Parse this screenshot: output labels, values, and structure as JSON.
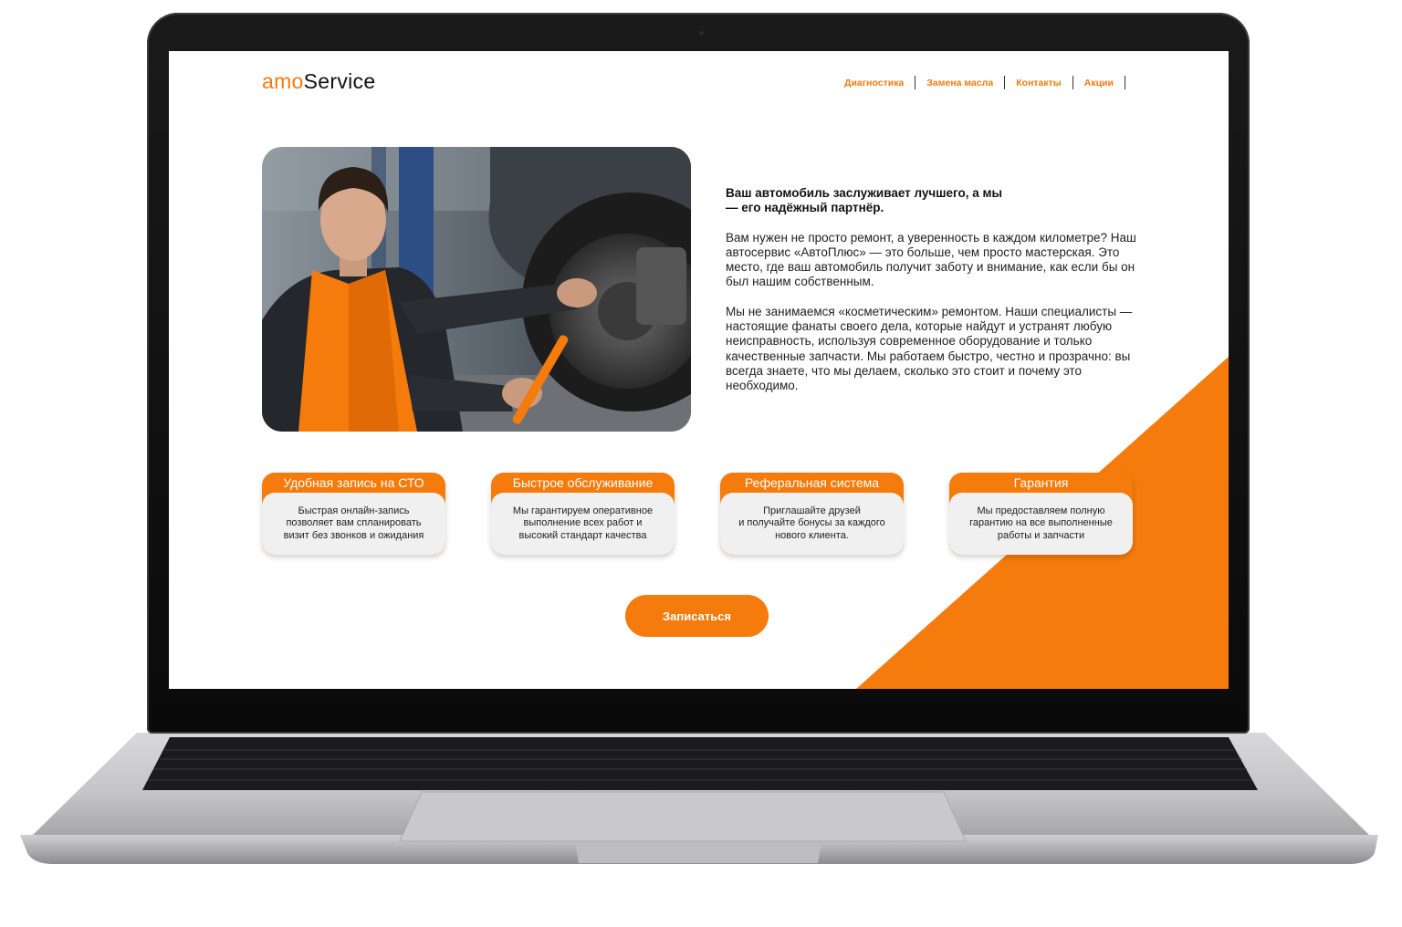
{
  "header": {
    "logo_prefix": "amo",
    "logo_suffix": "Service",
    "nav": [
      "Диагностика",
      "Замена масла",
      "Контакты",
      "Акции"
    ]
  },
  "hero": {
    "photo_alt": "Механик в оранжевом фартуке с гаечным ключом у тормозного диска автомобиля",
    "lead": "Ваш автомобиль заслуживает лучшего, а мы\n — его надёжный партнёр.",
    "paragraph1": "Вам нужен не просто ремонт, а уверенность в каждом километре? Наш автосервис «АвтоПлюс» — это больше, чем просто мастерская. Это место, где ваш автомобиль получит заботу и внимание, как если бы он был нашим собственным.",
    "paragraph2": "Мы не занимаемся «косметическим» ремонтом. Наши специалисты — настоящие фанаты своего дела, которые найдут и устранят любую неисправность, используя современное оборудование и только качественные запчасти. Мы работаем быстро, честно и прозрачно: вы всегда знаете, что мы делаем, сколько это стоит и почему это необходимо."
  },
  "features": [
    {
      "title": "Удобная запись на СТО",
      "text": "Быстрая онлайн-запись\nпозволяет вам спланировать\nвизит без звонков и ожидания"
    },
    {
      "title": "Быстрое обслуживание",
      "text": "Мы гарантируем оперативное\nвыполнение всех работ и\nвысокий стандарт качества"
    },
    {
      "title": "Реферальная система",
      "text": "Приглашайте друзей\nи получайте бонусы за каждого\nнового клиента."
    },
    {
      "title": "Гарантия",
      "text": "Мы предоставляем полную\nгарантию на все выполненные\nработы и запчасти"
    }
  ],
  "cta_label": "Записаться",
  "colors": {
    "accent": "#f47b0c",
    "card_bg": "#f0f0f0",
    "text": "#222222"
  }
}
